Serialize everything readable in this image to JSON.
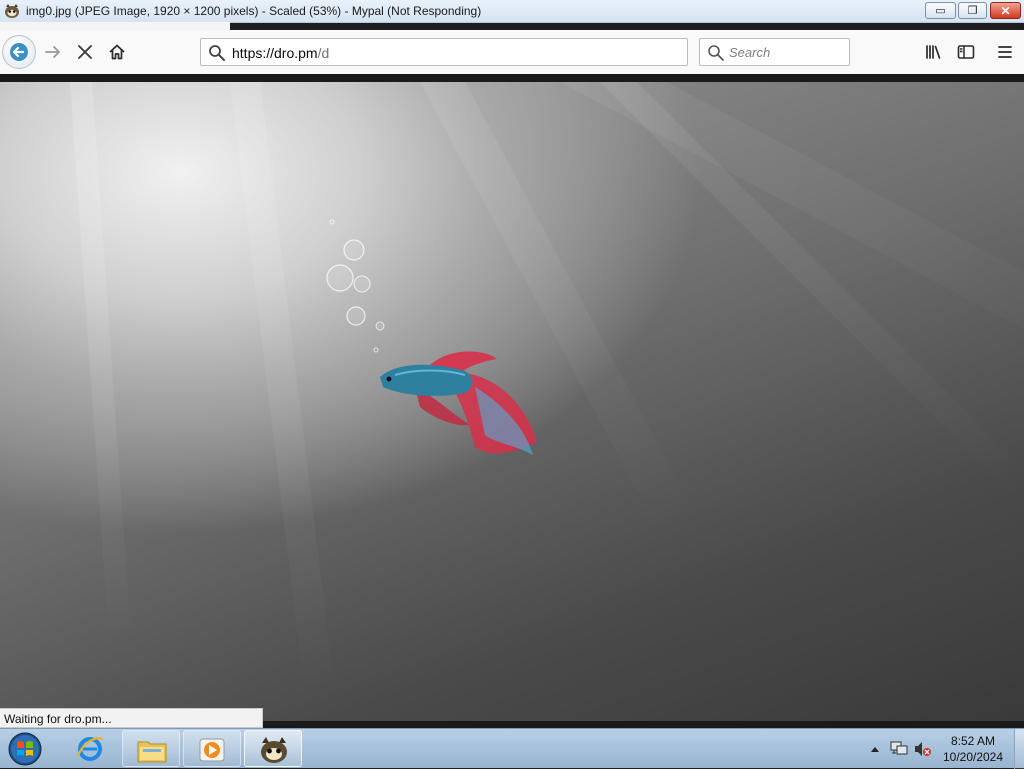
{
  "window": {
    "title": "img0.jpg (JPEG Image, 1920 × 1200 pixels) - Scaled (53%) - Mypal (Not Responding)",
    "minimize_glyph": "▭",
    "maximize_glyph": "❐",
    "close_glyph": "✕"
  },
  "navbar": {
    "back_icon": "back-arrow-icon",
    "forward_icon": "forward-arrow-icon",
    "stop_icon": "stop-icon",
    "home_icon": "home-icon",
    "url_host": "https://dro.pm",
    "url_path": "/d",
    "search_placeholder": "Search",
    "library_icon": "library-icon",
    "sidebar_icon": "sidebar-icon",
    "menu_icon": "hamburger-menu-icon"
  },
  "status": {
    "text": "Waiting for dro.pm..."
  },
  "taskbar": {
    "items": [
      "start-orb",
      "internet-explorer",
      "file-explorer",
      "media-player",
      "mypal"
    ],
    "clock_time": "8:52 AM",
    "clock_date": "10/20/2024"
  },
  "colors": {
    "titlebar": "#dce7f4",
    "taskbar": "#a7c1db",
    "fish_body": "#2f7f9e",
    "fish_fin": "#d8304a"
  }
}
